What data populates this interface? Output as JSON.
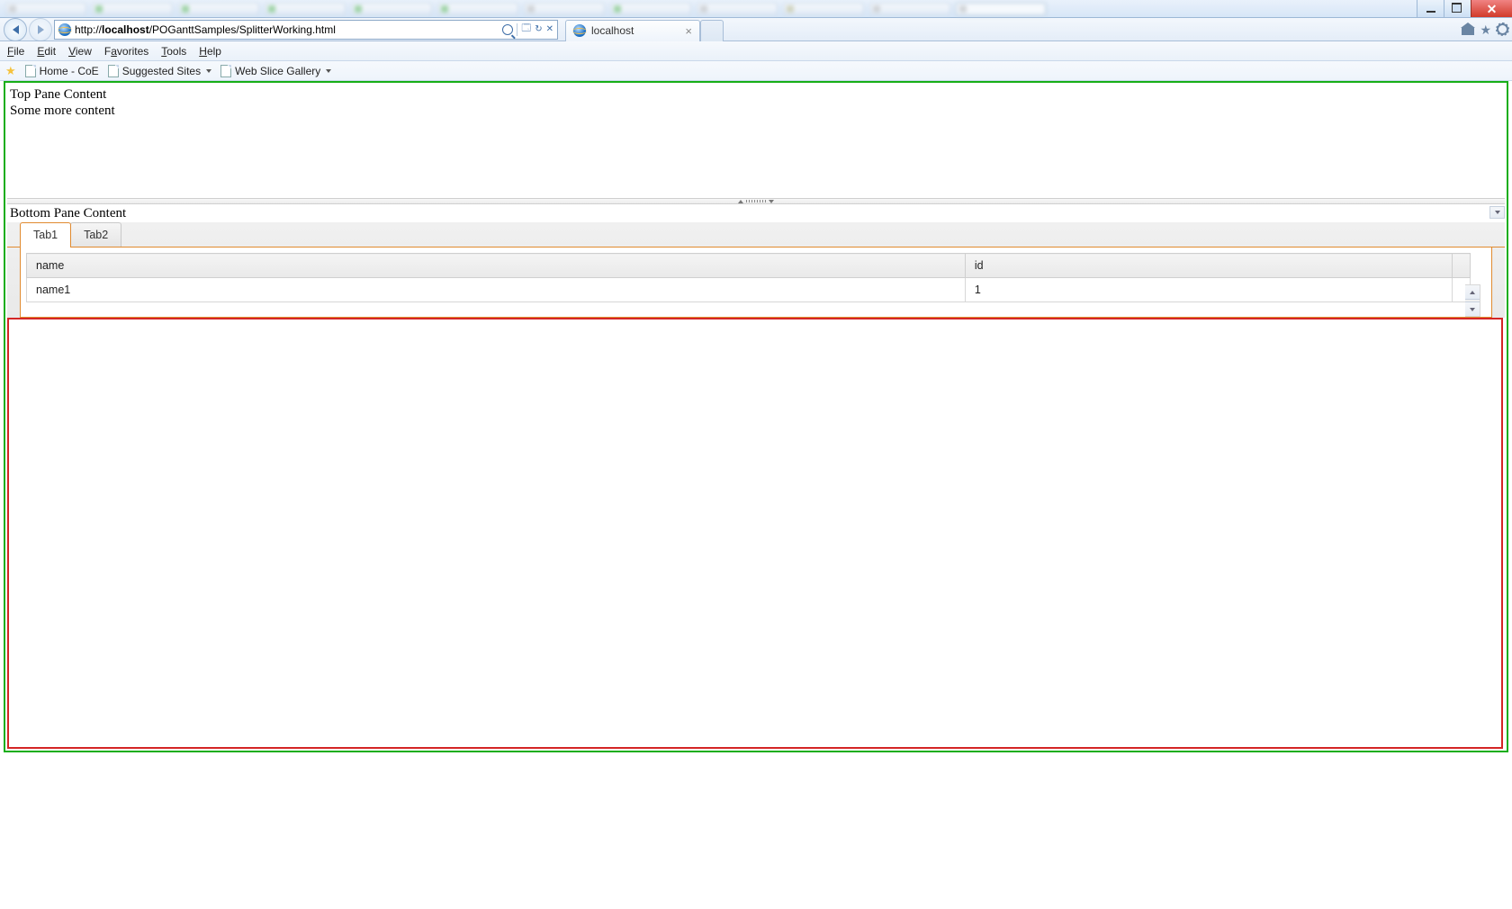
{
  "address_bar": {
    "prefix": "http://",
    "host": "localhost",
    "path": "/POGanttSamples/SplitterWorking.html"
  },
  "active_browser_tab": {
    "title": "localhost"
  },
  "menubar": [
    "File",
    "Edit",
    "View",
    "Favorites",
    "Tools",
    "Help"
  ],
  "favorites": {
    "items": [
      "Home - CoE",
      "Suggested Sites",
      "Web Slice Gallery"
    ]
  },
  "top_pane": {
    "line1": "Top Pane Content",
    "line2": "Some more content"
  },
  "bottom_pane": {
    "label": "Bottom Pane Content",
    "tabs": [
      "Tab1",
      "Tab2"
    ],
    "active_tab_index": 0,
    "grid": {
      "columns": [
        "name",
        "id"
      ],
      "rows": [
        {
          "name": "name1",
          "id": "1"
        }
      ]
    }
  }
}
